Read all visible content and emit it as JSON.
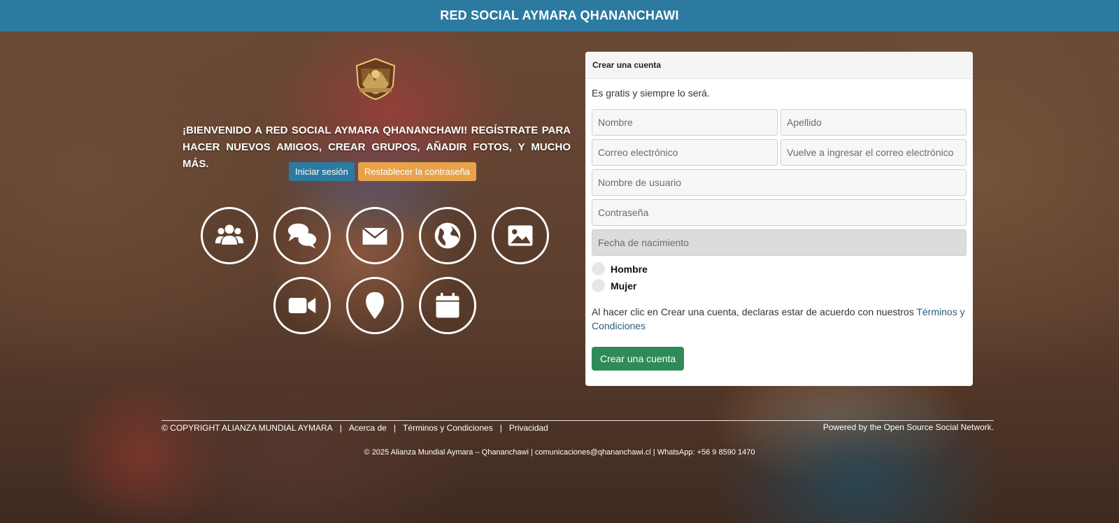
{
  "header": {
    "title": "RED SOCIAL AYMARA QHANANCHAWI"
  },
  "welcome": {
    "text": "¡Bienvenido a Red Social Aymara Qhananchawi! Regístrate para hacer nuevos amigos, crear grupos, añadir fotos, y mucho más.",
    "login_label": "Iniciar sesión",
    "reset_label": "Restablecer la contraseña"
  },
  "feature_icons": [
    "group-icon",
    "chat-icon",
    "envelope-icon",
    "globe-icon",
    "image-icon",
    "video-icon",
    "map-pin-icon",
    "calendar-icon"
  ],
  "colors": {
    "header": "#2c7aa0",
    "login": "#2c7aa0",
    "reset": "#e8a34a",
    "create": "#2e8b57"
  },
  "register": {
    "title": "Crear una cuenta",
    "subtitle": "Es gratis y siempre lo será.",
    "first_name_placeholder": "Nombre",
    "last_name_placeholder": "Apellido",
    "email_placeholder": "Correo electrónico",
    "email_repeat_placeholder": "Vuelve a ingresar el correo electrónico",
    "username_placeholder": "Nombre de usuario",
    "password_placeholder": "Contraseña",
    "birthdate_placeholder": "Fecha de nacimiento",
    "gender_male": "Hombre",
    "gender_female": "Mujer",
    "terms_prefix": "Al hacer clic en Crear una cuenta, declaras estar de acuerdo con nuestros ",
    "terms_link": "Términos y Condiciones",
    "submit_label": "Crear una cuenta"
  },
  "footer": {
    "copyright": "© COPYRIGHT ALIANZA MUNDIAL AYMARA",
    "links": [
      "Acerca de",
      "Términos y Condiciones",
      "Privacidad"
    ],
    "separator": "|",
    "powered": "Powered by the Open Source Social Network.",
    "bottom": "© 2025 Alianza Mundial Aymara – Qhananchawi | comunicaciones@qhananchawi.cl | WhatsApp: +56 9 8590 1470"
  }
}
